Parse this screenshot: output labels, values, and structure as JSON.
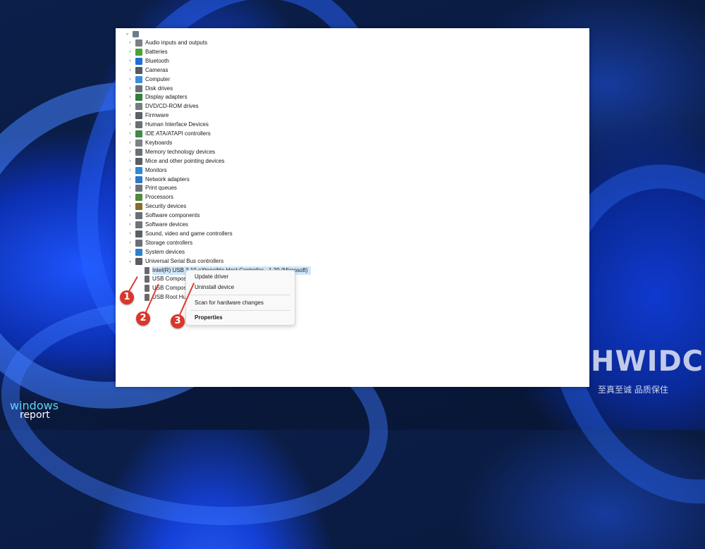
{
  "tree": {
    "root_chevron": "⌄",
    "categories": [
      {
        "label": "Audio inputs and outputs",
        "color": "#7a7f86"
      },
      {
        "label": "Batteries",
        "color": "#4aa23a"
      },
      {
        "label": "Bluetooth",
        "color": "#1f6fd6"
      },
      {
        "label": "Cameras",
        "color": "#555b63"
      },
      {
        "label": "Computer",
        "color": "#3a8fd8"
      },
      {
        "label": "Disk drives",
        "color": "#6b6f75"
      },
      {
        "label": "Display adapters",
        "color": "#2f7f3a"
      },
      {
        "label": "DVD/CD-ROM drives",
        "color": "#777b82"
      },
      {
        "label": "Firmware",
        "color": "#5c6168"
      },
      {
        "label": "Human Interface Devices",
        "color": "#6a6f76"
      },
      {
        "label": "IDE ATA/ATAPI controllers",
        "color": "#3f8a44"
      },
      {
        "label": "Keyboards",
        "color": "#7c8087"
      },
      {
        "label": "Memory technology devices",
        "color": "#6b7077"
      },
      {
        "label": "Mice and other pointing devices",
        "color": "#5a5f66"
      },
      {
        "label": "Monitors",
        "color": "#2f8ad6"
      },
      {
        "label": "Network adapters",
        "color": "#2f78c8"
      },
      {
        "label": "Print queues",
        "color": "#6d7178"
      },
      {
        "label": "Processors",
        "color": "#4e8a3c"
      },
      {
        "label": "Security devices",
        "color": "#8a6b2a"
      },
      {
        "label": "Software components",
        "color": "#6b7077"
      },
      {
        "label": "Software devices",
        "color": "#707479"
      },
      {
        "label": "Sound, video and game controllers",
        "color": "#5b6067"
      },
      {
        "label": "Storage controllers",
        "color": "#6a6e75"
      },
      {
        "label": "System devices",
        "color": "#2f7fd0"
      },
      {
        "label": "Universal Serial Bus controllers",
        "color": "#5a5e64"
      }
    ],
    "usb_children": [
      {
        "label": "Intel(R) USB 3.10 eXtensible Host Controller - 1.20 (Microsoft)",
        "selected": true
      },
      {
        "label": "USB Composite Device",
        "selected": false
      },
      {
        "label": "USB Composite Device",
        "selected": false
      },
      {
        "label": "USB Root Hub (USB 3.0)",
        "selected": false
      }
    ]
  },
  "context_menu": {
    "update": "Update driver",
    "uninstall": "Uninstall device",
    "scan": "Scan for hardware changes",
    "properties": "Properties"
  },
  "annotations": {
    "step1": "1",
    "step2": "2",
    "step3": "3",
    "color": "#d9372b"
  },
  "watermarks": {
    "hwidc": "HWIDC",
    "hwidc_sub": "至真至诚 品质保住",
    "windows": "windows",
    "report": "report"
  }
}
